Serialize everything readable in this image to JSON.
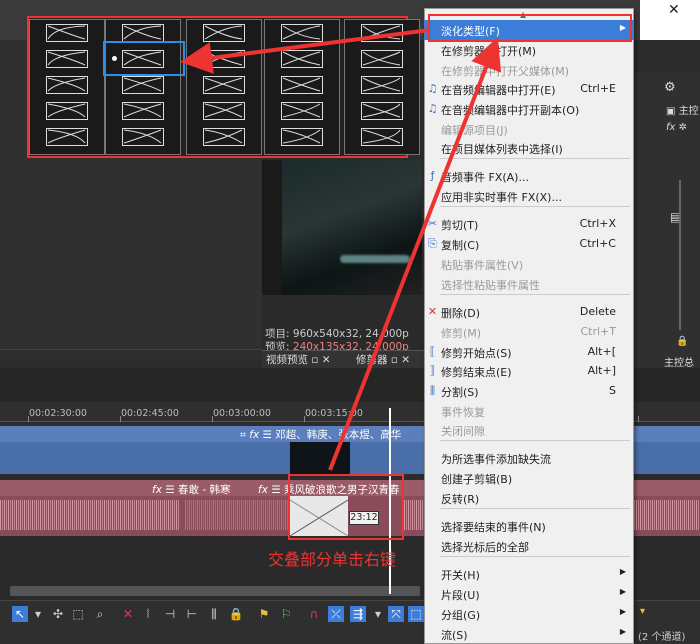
{
  "preview": {
    "project_label": "项目:",
    "project_value": "960x540x32, 24.000p",
    "preview_label": "预览:",
    "preview_value": "240x135x32, 24.000p",
    "tab_video_preview": "视频预览",
    "tab_trimmer": "修剪器"
  },
  "right_panel": {
    "main_label": "主控",
    "main_bus_label": "主控总"
  },
  "ruler": {
    "ticks": [
      "00:02:30:00",
      "00:02:45:00",
      "00:03:00:00",
      "00:03:15:00"
    ]
  },
  "tracks": {
    "video_clip_title": "邓超、韩庚、张本煜、高华",
    "audio_clip_left_title": "春敢 - 韩寒",
    "audio_clip_right_title": "乘风破浪歌之男子汉青春",
    "overlap_time": "23:12"
  },
  "annotation": {
    "caption": "交叠部分单击右键"
  },
  "context_menu": {
    "items": [
      {
        "label": "淡化类型(F)",
        "shortcut": "",
        "submenu": true,
        "disabled": false,
        "selected": true
      },
      {
        "label": "在修剪器中打开(M)",
        "shortcut": "",
        "submenu": false,
        "disabled": false
      },
      {
        "label": "在修剪器中打开父媒体(M)",
        "shortcut": "",
        "submenu": false,
        "disabled": true
      },
      {
        "label": "在音频编辑器中打开(E)",
        "shortcut": "Ctrl+E",
        "submenu": false,
        "disabled": false
      },
      {
        "label": "在音频编辑器中打开副本(O)",
        "shortcut": "",
        "submenu": false,
        "disabled": false
      },
      {
        "label": "编辑源项目(J)",
        "shortcut": "",
        "submenu": false,
        "disabled": true
      },
      {
        "label": "在项目媒体列表中选择(I)",
        "shortcut": "",
        "submenu": false,
        "disabled": false
      },
      {
        "label": "音频事件 FX(A)...",
        "shortcut": "",
        "submenu": false,
        "disabled": false
      },
      {
        "label": "应用非实时事件 FX(X)...",
        "shortcut": "",
        "submenu": false,
        "disabled": false
      },
      {
        "label": "剪切(T)",
        "shortcut": "Ctrl+X",
        "submenu": false,
        "disabled": false
      },
      {
        "label": "复制(C)",
        "shortcut": "Ctrl+C",
        "submenu": false,
        "disabled": false
      },
      {
        "label": "粘贴事件属性(V)",
        "shortcut": "",
        "submenu": false,
        "disabled": true
      },
      {
        "label": "选择性粘贴事件属性",
        "shortcut": "",
        "submenu": false,
        "disabled": true
      },
      {
        "label": "删除(D)",
        "shortcut": "Delete",
        "submenu": false,
        "disabled": false
      },
      {
        "label": "修剪(M)",
        "shortcut": "Ctrl+T",
        "submenu": false,
        "disabled": true
      },
      {
        "label": "修剪开始点(S)",
        "shortcut": "Alt+[",
        "submenu": false,
        "disabled": false
      },
      {
        "label": "修剪结束点(E)",
        "shortcut": "Alt+]",
        "submenu": false,
        "disabled": false
      },
      {
        "label": "分割(S)",
        "shortcut": "S",
        "submenu": false,
        "disabled": false
      },
      {
        "label": "事件恢复",
        "shortcut": "",
        "submenu": false,
        "disabled": true
      },
      {
        "label": "关闭间隙",
        "shortcut": "",
        "submenu": false,
        "disabled": true
      },
      {
        "label": "为所选事件添加缺失流",
        "shortcut": "",
        "submenu": false,
        "disabled": false
      },
      {
        "label": "创建子剪辑(B)",
        "shortcut": "",
        "submenu": false,
        "disabled": false
      },
      {
        "label": "反转(R)",
        "shortcut": "",
        "submenu": false,
        "disabled": false
      },
      {
        "label": "选择要结束的事件(N)",
        "shortcut": "",
        "submenu": false,
        "disabled": false
      },
      {
        "label": "选择光标后的全部",
        "shortcut": "",
        "submenu": false,
        "disabled": false
      },
      {
        "label": "开关(H)",
        "shortcut": "",
        "submenu": true,
        "disabled": false
      },
      {
        "label": "片段(U)",
        "shortcut": "",
        "submenu": true,
        "disabled": false
      },
      {
        "label": "分组(G)",
        "shortcut": "",
        "submenu": true,
        "disabled": false
      },
      {
        "label": "流(S)",
        "shortcut": "",
        "submenu": true,
        "disabled": false
      }
    ]
  },
  "status": {
    "bottom_right": "(2 个通道)"
  },
  "icons": {
    "fx": "fx-icon",
    "menu": "menu-lines-icon",
    "crop": "crop-icon",
    "cut": "scissors-icon",
    "copy": "copy-icon",
    "delete": "delete-x-icon",
    "gear": "gear-icon"
  }
}
